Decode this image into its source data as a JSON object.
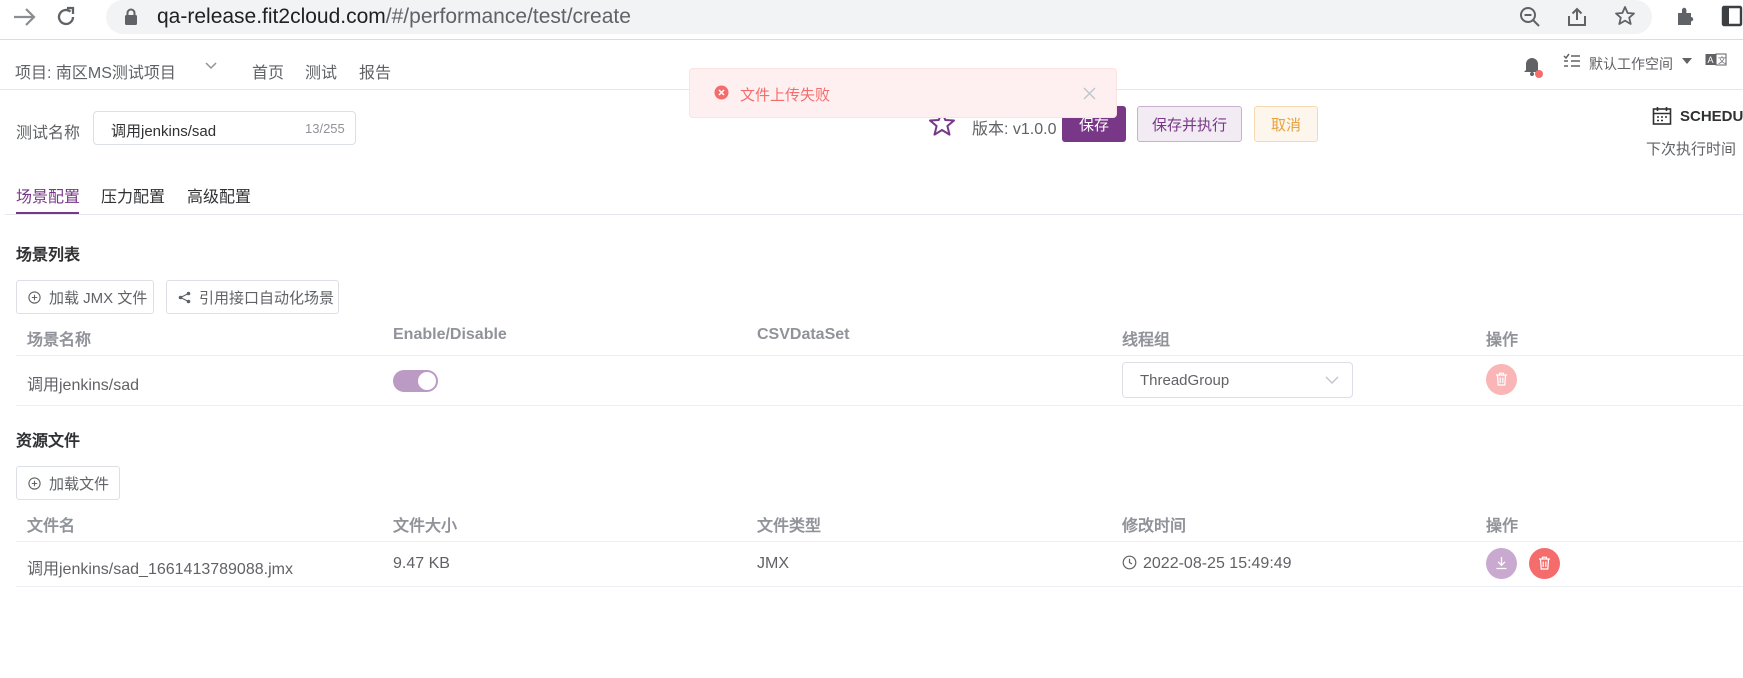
{
  "browser": {
    "url_host": "qa-release.fit2cloud.com",
    "url_path": "/#/performance/test/create"
  },
  "header": {
    "project_label": "项目: 南区MS测试项目",
    "nav": [
      "首页",
      "测试",
      "报告"
    ],
    "workspace": "默认工作空间"
  },
  "toast": {
    "message": "文件上传失败"
  },
  "form": {
    "name_label": "测试名称",
    "name_value": "调用jenkins/sad",
    "name_counter": "13/255",
    "version": "版本: v1.0.0",
    "save": "保存",
    "save_and_run": "保存并执行",
    "cancel": "取消",
    "schedule_title": "SCHEDULE",
    "next_run_label": "下次执行时间"
  },
  "tabs": [
    "场景配置",
    "压力配置",
    "高级配置"
  ],
  "scenes": {
    "title": "场景列表",
    "load_jmx": "加载 JMX 文件",
    "ref_api": "引用接口自动化场景",
    "columns": [
      "场景名称",
      "Enable/Disable",
      "CSVDataSet",
      "线程组",
      "操作"
    ],
    "row": {
      "name": "调用jenkins/sad",
      "enabled": true,
      "thread_group": "ThreadGroup"
    }
  },
  "resources": {
    "title": "资源文件",
    "load_file": "加载文件",
    "columns": [
      "文件名",
      "文件大小",
      "文件类型",
      "修改时间",
      "操作"
    ],
    "row": {
      "file_name": "调用jenkins/sad_1661413789088.jmx",
      "size": "9.47 KB",
      "type": "JMX",
      "modified": "2022-08-25 15:49:49"
    }
  },
  "colors": {
    "primary": "#783887",
    "toggle_on": "#bb9ac3",
    "danger": "#f56c6c",
    "danger_light": "#fab6b6",
    "download": "#c9a9cf"
  }
}
